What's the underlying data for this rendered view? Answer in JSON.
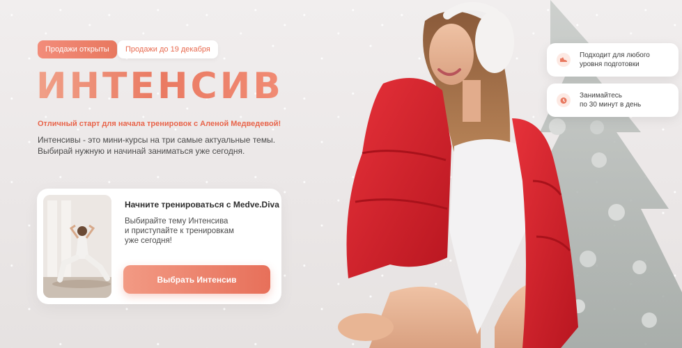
{
  "badges": {
    "open": "Продажи открыты",
    "deadline": "Продажи до 19 декабря"
  },
  "hero": {
    "title": "ИНТЕНСИВ",
    "subtitle": "Отличный старт для начала тренировок с Аленой Медведевой!",
    "description": "Интенсивы - это мини-курсы на три самые актуальные темы. Выбирай нужную и начинай заниматься уже сегодня."
  },
  "card": {
    "title": "Начните тренироваться с Medve.Diva",
    "text_line1": "Выбирайте тему Интенсива",
    "text_line2": "и приступайте к тренировкам",
    "text_line3": "уже сегодня!",
    "button_label": "Выбрать Интенсив"
  },
  "features": [
    {
      "icon": "shoe-icon",
      "line1": "Подходит для любого",
      "line2": "уровня подготовки"
    },
    {
      "icon": "alarm-clock-icon",
      "line1": "Занимайтесь",
      "line2": "по 30 минут в день"
    }
  ],
  "colors": {
    "accent": "#e8785f",
    "accent_light": "#f29a84",
    "jacket_red": "#d8202a",
    "background": "#efecec"
  }
}
